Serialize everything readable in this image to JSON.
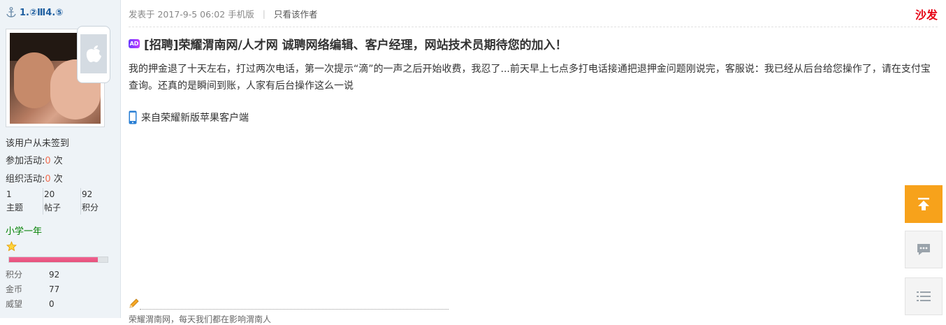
{
  "user": {
    "name": "1.②Ⅲ4.⑤",
    "signin_status": "该用户从未签到",
    "activities_joined_label": "参加活动:",
    "activities_joined_value": "0",
    "activities_joined_unit": " 次",
    "activities_organized_label": "组织活动:",
    "activities_organized_value": "0",
    "activities_organized_unit": " 次",
    "stats": [
      {
        "value": "1",
        "label": "主题"
      },
      {
        "value": "20",
        "label": "帖子"
      },
      {
        "value": "92",
        "label": "积分"
      }
    ],
    "level": "小学一年",
    "level_progress": 0.9,
    "credits": [
      {
        "label": "积分",
        "value": "92"
      },
      {
        "label": "金币",
        "value": "77"
      },
      {
        "label": "威望",
        "value": "0"
      }
    ]
  },
  "post": {
    "posted_at": "发表于 2017-9-5 06:02",
    "device": "手机版",
    "separator": "|",
    "author_only": "只看该作者",
    "floor": "沙发",
    "ad_badge": "AD",
    "title": "[招聘]荣耀渭南网/人才网 诚聘网络编辑、客户经理，网站技术员期待您的加入！",
    "body": "我的押金退了十天左右，打过两次电话，第一次提示“滴”的一声之后开始收费，我忍了...前天早上七点多打电话接通把退押金问题刚说完，客服说：我已经从后台给您操作了，请在支付宝查询。还真的是瞬间到账，人家有后台操作这么一说",
    "client": "来自荣耀新版苹果客户端",
    "signature": "荣耀渭南网，每天我们都在影响渭南人"
  },
  "colors": {
    "accent_orange": "#f7a21b",
    "floor_red": "#e60012",
    "level_green": "#008000",
    "link_blue": "#1f5fa0"
  },
  "icons": [
    "anchor-icon",
    "apple-icon",
    "ad-badge",
    "phone-icon",
    "star-icon",
    "pencil-icon",
    "back-to-top-icon",
    "chat-icon",
    "list-icon"
  ]
}
